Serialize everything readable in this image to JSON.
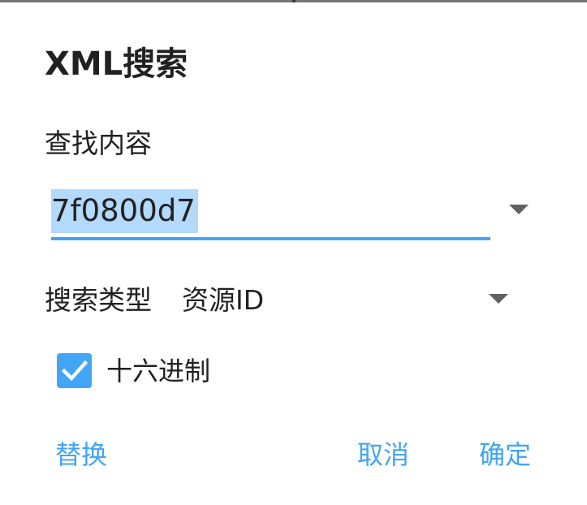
{
  "dialog": {
    "title": "XML搜索",
    "find_label": "查找内容",
    "find_value": "7f0800d7",
    "search_type_label": "搜索类型",
    "search_type_value": "资源ID",
    "hex_checkbox": {
      "label": "十六进制",
      "checked": true
    },
    "buttons": {
      "replace": "替换",
      "cancel": "取消",
      "confirm": "确定"
    }
  },
  "colors": {
    "accent": "#42a5f5",
    "selection_highlight": "#b3d9fb",
    "text_primary": "#212121",
    "icon_gray": "#616161"
  },
  "icons": {
    "history_dropdown": "chevron-down-icon",
    "search_type_dropdown": "chevron-down-icon",
    "checkbox": "checkmark-icon"
  }
}
